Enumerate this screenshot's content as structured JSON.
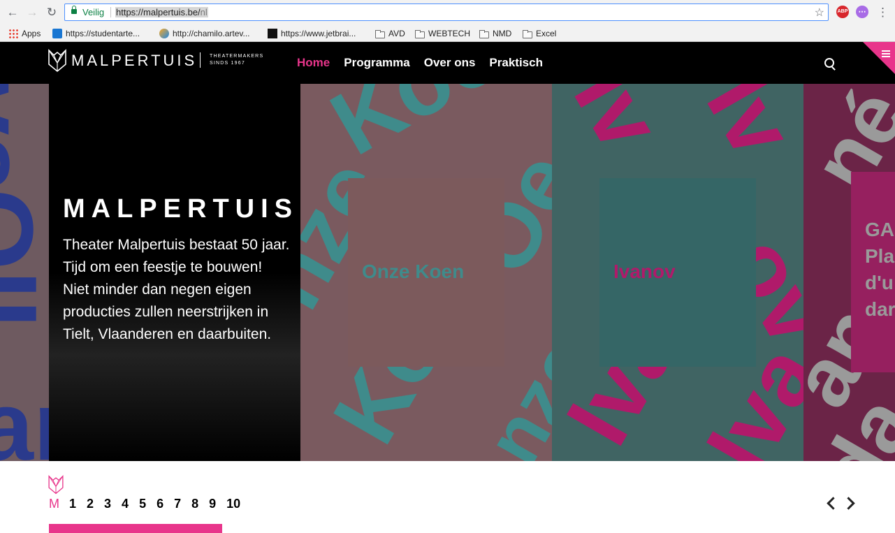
{
  "browser": {
    "secure_label": "Veilig",
    "url_host": "https://malpertuis.be/",
    "url_path": "nl",
    "bookmarks": [
      {
        "label": "Apps",
        "icon": "apps-grid-icon"
      },
      {
        "label": "https://studentarte...",
        "icon": "sharepoint-icon"
      },
      {
        "label": "http://chamilo.artev...",
        "icon": "chamilo-icon"
      },
      {
        "label": "https://www.jetbrai...",
        "icon": "jetbrains-icon"
      },
      {
        "label": "AVD",
        "icon": "folder-icon"
      },
      {
        "label": "WEBTECH",
        "icon": "folder-icon"
      },
      {
        "label": "NMD",
        "icon": "folder-icon"
      },
      {
        "label": "Excel",
        "icon": "folder-icon"
      }
    ],
    "ext_abp": "ABP"
  },
  "site": {
    "brand": "MALPERTUIS",
    "tagline_1": "THEATERMAKERS",
    "tagline_2": "SINDS 1967",
    "nav": [
      "Home",
      "Programma",
      "Over ons",
      "Praktisch"
    ],
    "accent": "#e8358b"
  },
  "hero": {
    "title": "MALPERTUIS",
    "text": "Theater Malpertuis bestaat 50 jaar. Tijd om een feestje te bouwen! Niet minder dan negen eigen producties zullen neerstrijken in Tielt, Vlaanderen en daarbuiten.",
    "cards": [
      {
        "title": "Onze Koen"
      },
      {
        "title": "Ivanov"
      }
    ],
    "partial_card": {
      "line1": "GA",
      "line2": "Pla",
      "line3": "d'u",
      "line4": "dar"
    }
  },
  "pager": {
    "m_label": "M",
    "pages": [
      "1",
      "2",
      "3",
      "4",
      "5",
      "6",
      "7",
      "8",
      "9",
      "10"
    ],
    "progress": 0.2
  }
}
